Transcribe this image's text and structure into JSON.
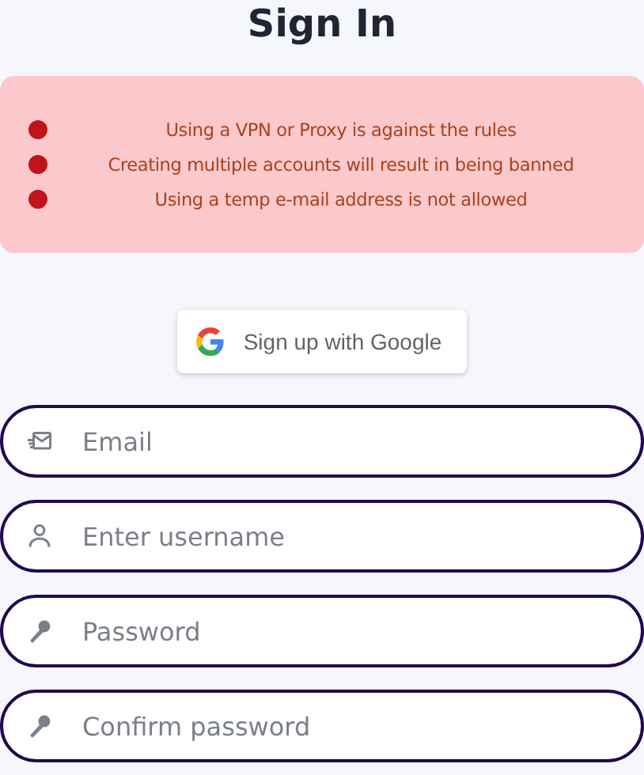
{
  "title": "Sign In",
  "notice": {
    "items": [
      {
        "text": "Using a VPN or Proxy is against the rules"
      },
      {
        "text": "Creating multiple accounts will result in being banned"
      },
      {
        "text": "Using a temp e-mail address is not allowed"
      }
    ]
  },
  "google_button": {
    "label": "Sign up with Google"
  },
  "fields": [
    {
      "kind": "email",
      "placeholder": "Email"
    },
    {
      "kind": "user",
      "placeholder": "Enter username"
    },
    {
      "kind": "password",
      "placeholder": "Password"
    },
    {
      "kind": "password",
      "placeholder": "Confirm password"
    }
  ]
}
